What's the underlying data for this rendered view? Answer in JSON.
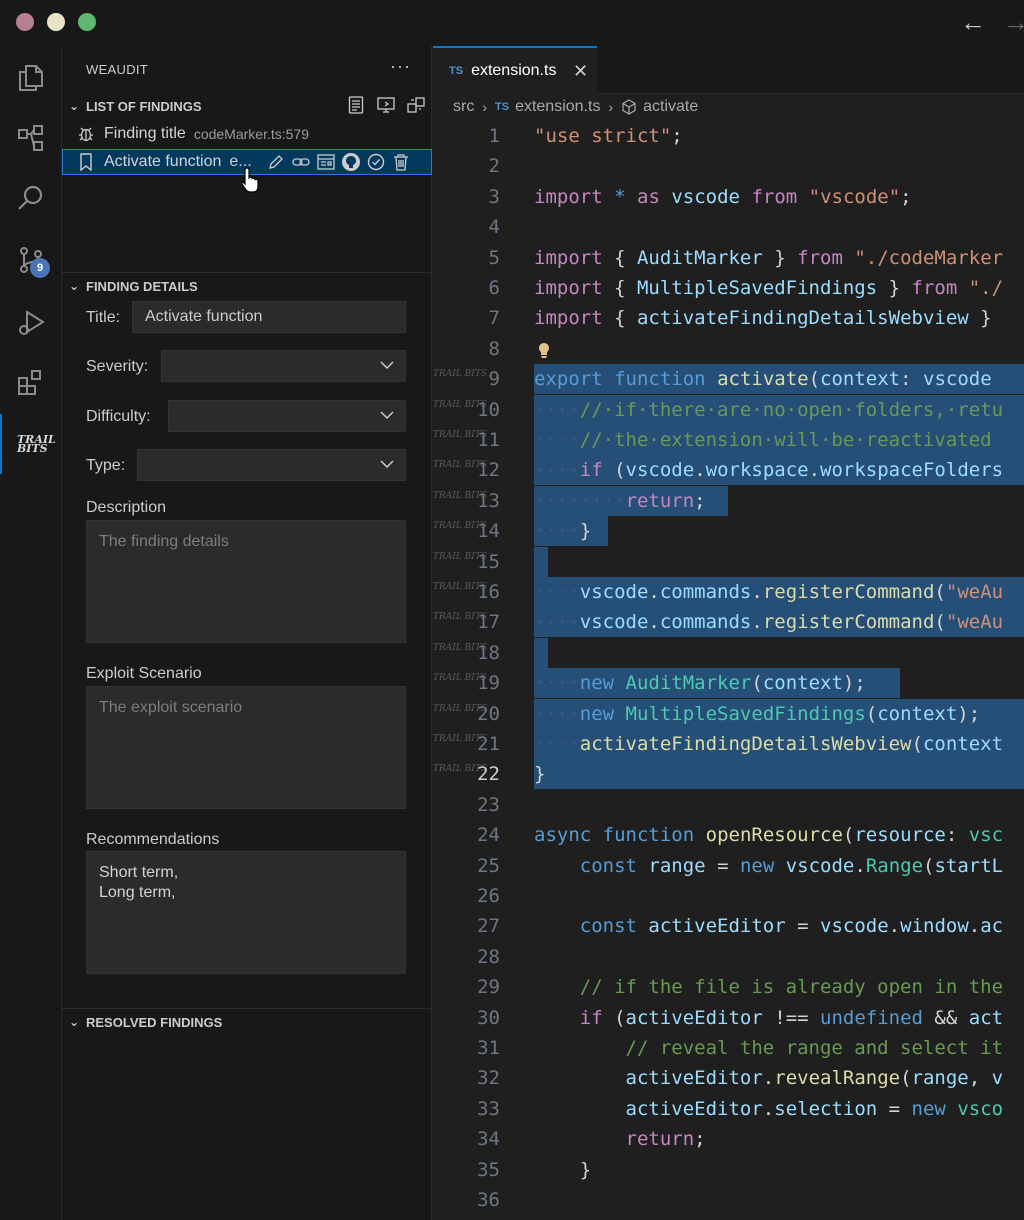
{
  "sidebar": {
    "title": "WEAUDIT",
    "list_section": "LIST OF FINDINGS",
    "findings": [
      {
        "label": "Finding title",
        "description": "codeMarker.ts:579"
      },
      {
        "label": "Activate function",
        "description": "e..."
      }
    ],
    "details_section": "FINDING DETAILS",
    "title_label": "Title:",
    "title_value": "Activate function",
    "severity_label": "Severity:",
    "difficulty_label": "Difficulty:",
    "type_label": "Type:",
    "description_label": "Description",
    "description_placeholder": "The finding details",
    "exploit_label": "Exploit Scenario",
    "exploit_placeholder": "The exploit scenario",
    "recommendations_label": "Recommendations",
    "recommendations_value": "Short term,\nLong term,",
    "resolved_section": "RESOLVED FINDINGS"
  },
  "activity": {
    "scm_badge": "9",
    "trailbits_logo": "TRAIL BITS"
  },
  "editor": {
    "tab": {
      "lang": "TS",
      "name": "extension.ts"
    },
    "breadcrumb": {
      "folder": "src",
      "file_lang": "TS",
      "file": "extension.ts",
      "symbol": "activate"
    },
    "current_line": "22",
    "gutter_mark": "TRAIL BITS"
  },
  "colors": {
    "accent": "#0078d4",
    "selection": "#264f78",
    "keyword": "#569cd6",
    "string": "#ce9178",
    "function": "#dcdcaa"
  }
}
